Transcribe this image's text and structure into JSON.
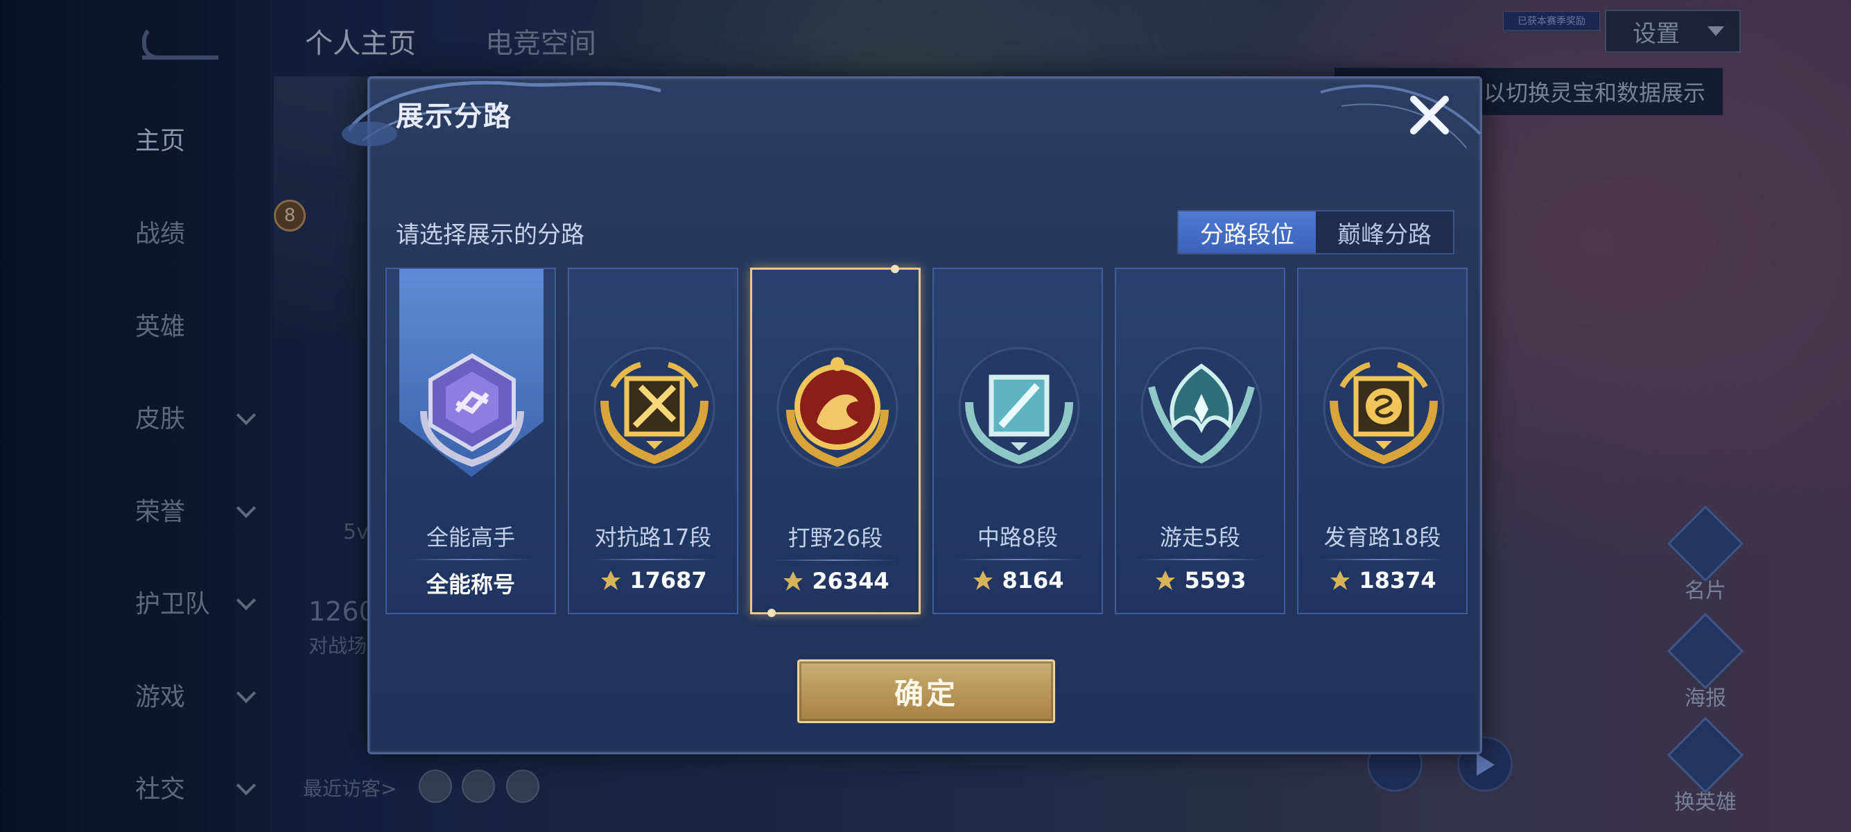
{
  "background": {
    "top_tabs": [
      "个人主页",
      "电竞空间"
    ],
    "nav_items": [
      {
        "label": "主页",
        "active": true
      },
      {
        "label": "战绩"
      },
      {
        "label": "英雄"
      },
      {
        "label": "皮肤",
        "has_chevron": true
      },
      {
        "label": "荣誉",
        "has_chevron": true
      },
      {
        "label": "护卫队",
        "has_chevron": true
      },
      {
        "label": "游戏",
        "has_chevron": true
      },
      {
        "label": "社交",
        "has_chevron": true
      }
    ],
    "level_badge": "8",
    "stat_value": "1260",
    "stat_sub": "对战场",
    "mode_label": "5v",
    "recent_visitors_label": "最近访客>",
    "settings_label": "设置",
    "tiny_badge": "已获本赛季奖励",
    "tooltip_text": "以切换灵宝和数据展示",
    "side_actions": [
      "名片",
      "海报",
      "换英雄"
    ]
  },
  "modal": {
    "title": "展示分路",
    "subtitle": "请选择展示的分路",
    "tabs": [
      {
        "label": "分路段位",
        "active": true
      },
      {
        "label": "巅峰分路",
        "active": false
      }
    ],
    "cards": [
      {
        "label": "全能高手",
        "value": "全能称号",
        "emblem": "purple-allround-emblem",
        "has_banner": true
      },
      {
        "label": "对抗路17段",
        "value": "17687",
        "emblem": "gold-sword-emblem",
        "show_icon": true
      },
      {
        "label": "打野26段",
        "value": "26344",
        "emblem": "gold-dragon-emblem",
        "show_icon": true,
        "selected": true
      },
      {
        "label": "中路8段",
        "value": "8164",
        "emblem": "teal-staff-emblem",
        "show_icon": true
      },
      {
        "label": "游走5段",
        "value": "5593",
        "emblem": "teal-wings-emblem",
        "show_icon": true
      },
      {
        "label": "发育路18段",
        "value": "18374",
        "emblem": "gold-coin-emblem",
        "show_icon": true
      }
    ],
    "confirm_label": "确定"
  },
  "colors": {
    "accent_blue": "#4f7ad0",
    "gold": "#e9c98a",
    "modal_bg": "#243559"
  }
}
